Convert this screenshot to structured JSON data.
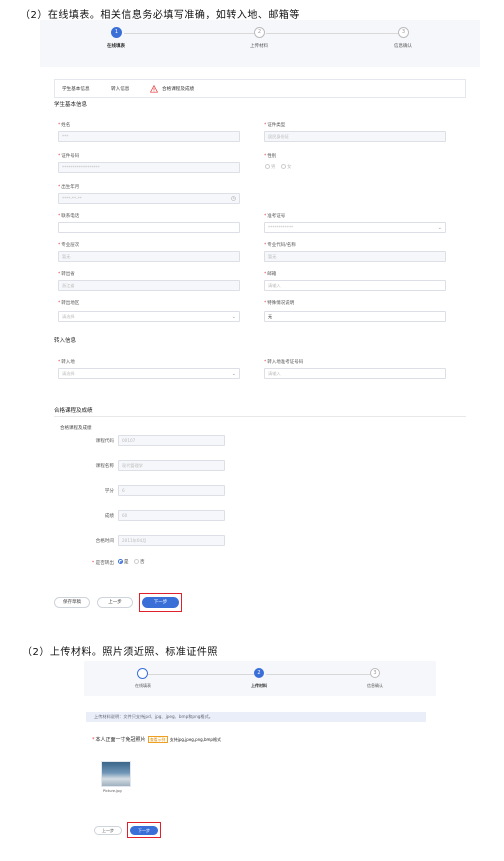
{
  "heading_1": "（2）在线填表。相关信息务必填写准确，如转入地、邮箱等",
  "heading_2": "（2）上传材料。照片须近照、标准证件照",
  "steps": [
    {
      "num": "1",
      "label": "在线填表"
    },
    {
      "num": "2",
      "label": "上传材料"
    },
    {
      "num": "3",
      "label": "信息确认"
    }
  ],
  "tabs": {
    "basic": "学生基本信息",
    "transfer": "转入信息",
    "courses": "合格课程及成绩"
  },
  "basic_section": {
    "title": "学生基本信息",
    "name_label": "姓名",
    "name_value": "***",
    "idtype_label": "证件类型",
    "idtype_value": "居民身份证",
    "idno_label": "证件号码",
    "idno_value": "******************",
    "gender_label": "性别",
    "gender_male": "男",
    "gender_female": "女",
    "birth_label": "出生年月",
    "birth_value": "****-**-**",
    "phone_label": "联系电话",
    "exam_no_label": "准考证号",
    "exam_no_value": "************",
    "level_label": "专业层次",
    "level_value": "暂无",
    "major_label": "专业代码/名称",
    "major_value": "暂无",
    "out_province_label": "转出省",
    "out_province_value": "浙江省",
    "email_label": "邮箱",
    "email_placeholder": "请输入",
    "out_area_label": "转出地区",
    "out_area_placeholder": "请选择",
    "special_label": "特殊情况说明",
    "special_value": "无"
  },
  "transfer_section": {
    "title": "转入信息",
    "in_place_label": "转入地",
    "in_place_placeholder": "请选择",
    "in_exam_label": "转入地准考证号码",
    "in_exam_placeholder": "请输入"
  },
  "course_section": {
    "title": "合格课程及成绩",
    "subtitle": "合格课程及成绩",
    "code_label": "课程代码",
    "code_value": "00107",
    "name_label": "课程名称",
    "name_value": "现代管理学",
    "credit_label": "学分",
    "credit_value": "6",
    "score_label": "成绩",
    "score_value": "60",
    "date_label": "合格时间",
    "date_value": "2011年04月",
    "out_label": "是否转出",
    "out_yes": "是",
    "out_no": "否"
  },
  "buttons": {
    "save_draft": "保存草稿",
    "prev": "上一步",
    "next": "下一步"
  },
  "upload_page": {
    "notice": "上传材料说明：文件只支持jpd、jpg、jpeg、bmp和png格式。",
    "photo_label": "本人正面一寸免冠照片",
    "badge": "查看示例",
    "format_hint": "支持jpg,jpeg,png,bmp格式",
    "thumb_caption": "Picture.jpg",
    "prev": "上一步",
    "next": "下一步"
  }
}
